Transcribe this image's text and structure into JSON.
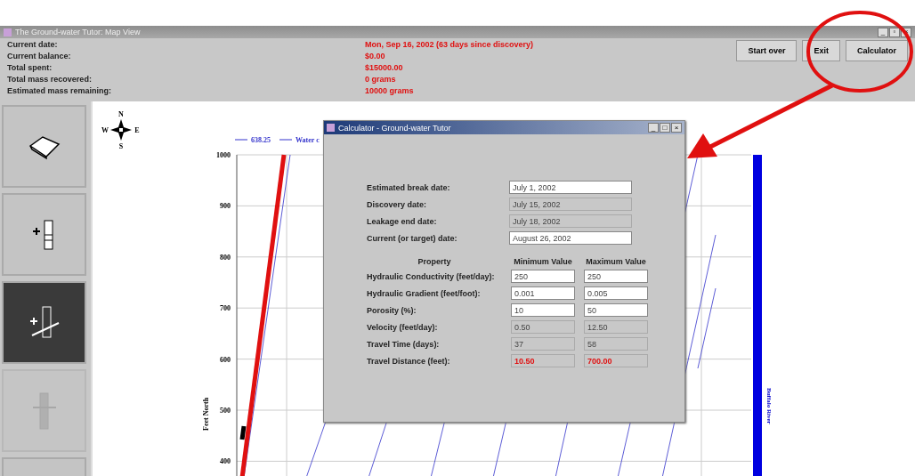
{
  "window": {
    "title": "The Ground-water Tutor: Map View",
    "controls": [
      "_",
      "▫",
      "×"
    ]
  },
  "status": [
    {
      "label": "Current date:",
      "value": "Mon, Sep 16, 2002 (63 days since discovery)"
    },
    {
      "label": "Current balance:",
      "value": "$0.00"
    },
    {
      "label": "Total spent:",
      "value": "$15000.00"
    },
    {
      "label": "Total mass recovered:",
      "value": "0 grams"
    },
    {
      "label": "Estimated mass remaining:",
      "value": "10000 grams"
    }
  ],
  "buttons": [
    "Start over",
    "Exit",
    "Calculator"
  ],
  "tools": [
    {
      "selected": false,
      "disabled": false
    },
    {
      "selected": false,
      "disabled": false
    },
    {
      "selected": true,
      "disabled": false
    },
    {
      "selected": false,
      "disabled": true
    },
    {
      "selected": false,
      "disabled": false
    }
  ],
  "compass": {
    "n": "N",
    "e": "E",
    "s": "S",
    "w": "W"
  },
  "map": {
    "legend": [
      "638.25",
      "Water c"
    ],
    "y_ticks": [
      "1000",
      "900",
      "800",
      "700",
      "600",
      "500",
      "400"
    ],
    "ylabel": "Feet North",
    "river": "Buffalo River"
  },
  "calculator": {
    "title": "Calculator - Ground-water Tutor",
    "controls": [
      "_",
      "□",
      "×"
    ],
    "dates": [
      {
        "label": "Estimated break date:",
        "value": "July 1, 2002",
        "editable": true
      },
      {
        "label": "Discovery date:",
        "value": "July 15, 2002",
        "editable": false
      },
      {
        "label": "Leakage end date:",
        "value": "July 18, 2002",
        "editable": false
      },
      {
        "label": "Current (or target) date:",
        "value": "August 26, 2002",
        "editable": true
      }
    ],
    "columns": [
      "Property",
      "Minimum Value",
      "Maximum Value"
    ],
    "rows": [
      {
        "label": "Hydraulic Conductivity (feet/day):",
        "min": "250",
        "max": "250",
        "editable": true,
        "alert": false
      },
      {
        "label": "Hydraulic Gradient (feet/foot):",
        "min": "0.001",
        "max": "0.005",
        "editable": true,
        "alert": false
      },
      {
        "label": "Porosity (%):",
        "min": "10",
        "max": "50",
        "editable": true,
        "alert": false
      },
      {
        "label": "Velocity (feet/day):",
        "min": "0.50",
        "max": "12.50",
        "editable": false,
        "alert": false
      },
      {
        "label": "Travel Time (days):",
        "min": "37",
        "max": "58",
        "editable": false,
        "alert": false
      },
      {
        "label": "Travel Distance (feet):",
        "min": "10.50",
        "max": "700.00",
        "editable": false,
        "alert": true
      }
    ]
  }
}
